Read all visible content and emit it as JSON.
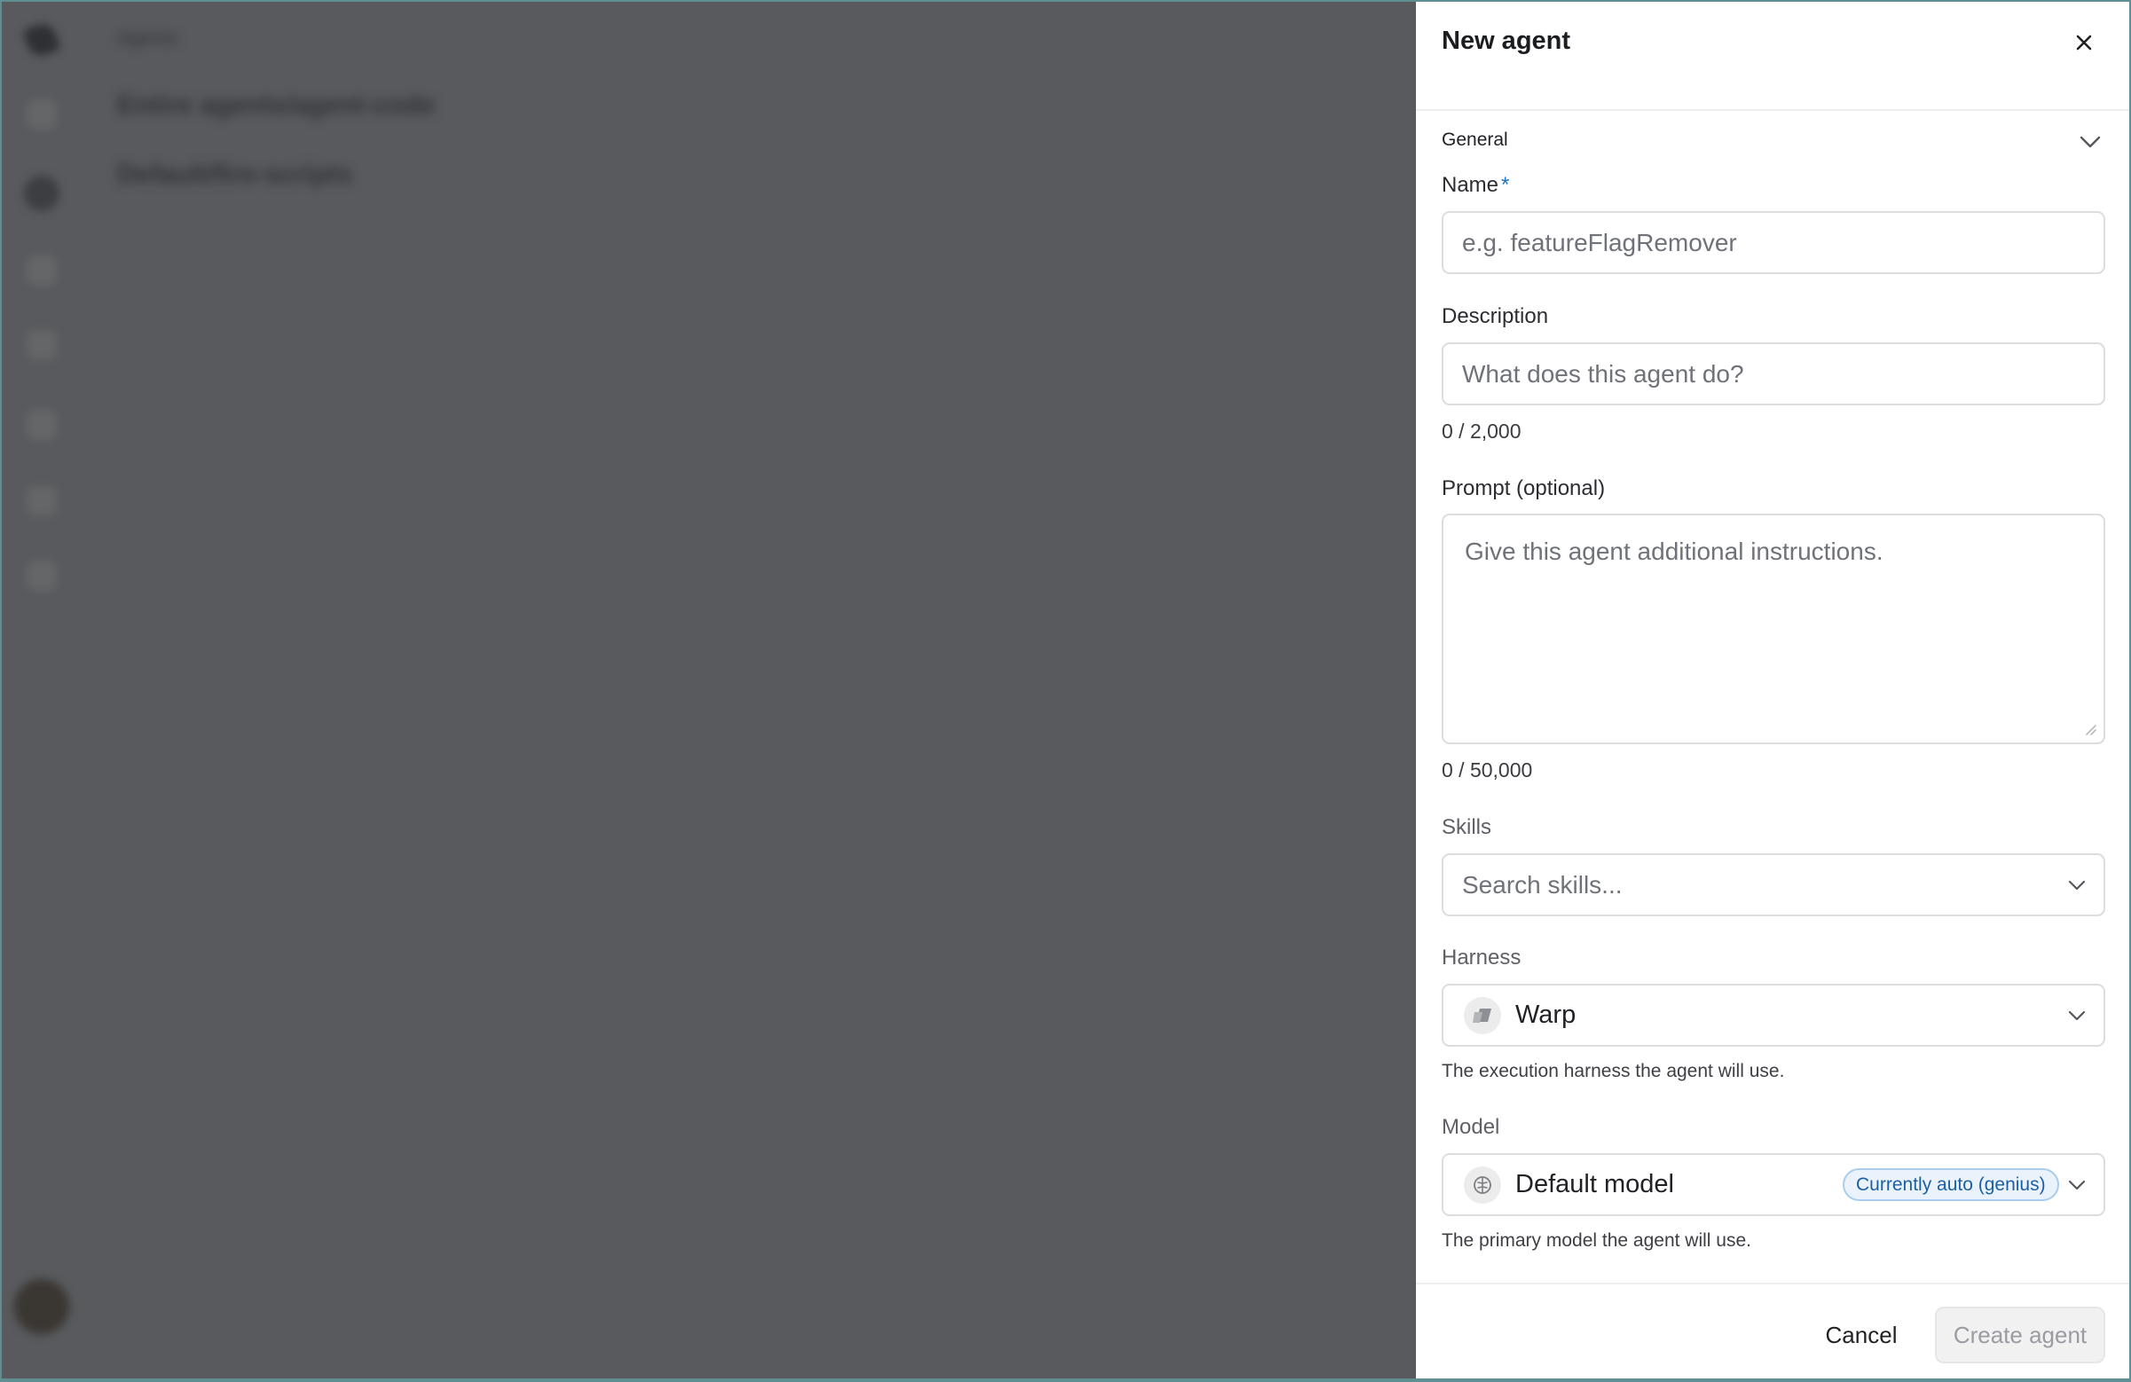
{
  "background": {
    "breadcrumb": "Agents",
    "rows": [
      "Entire agents/agent-code",
      "Default/fire-scripts"
    ]
  },
  "panel": {
    "title": "New agent",
    "section": "General",
    "name": {
      "label": "Name",
      "required_mark": "*",
      "placeholder": "e.g. featureFlagRemover"
    },
    "description": {
      "label": "Description",
      "placeholder": "What does this agent do?",
      "counter": "0 / 2,000"
    },
    "prompt": {
      "label": "Prompt (optional)",
      "placeholder": "Give this agent additional instructions.",
      "counter": "0 / 50,000"
    },
    "skills": {
      "label": "Skills",
      "placeholder": "Search skills..."
    },
    "harness": {
      "label": "Harness",
      "value": "Warp",
      "icon": "warp-icon",
      "helper": "The execution harness the agent will use."
    },
    "model": {
      "label": "Model",
      "value": "Default model",
      "icon": "brain-icon",
      "badge": "Currently auto (genius)",
      "helper": "The primary model the agent will use."
    },
    "actions": {
      "cancel": "Cancel",
      "create": "Create agent"
    }
  },
  "colors": {
    "overlay": "#585a5d",
    "panel_bg": "#ffffff",
    "required": "#1a73c9",
    "badge_text": "#1d5fa5",
    "badge_bg": "#eaf3fc",
    "badge_border": "#a9cdee",
    "disabled_text": "#9a9ca1"
  }
}
